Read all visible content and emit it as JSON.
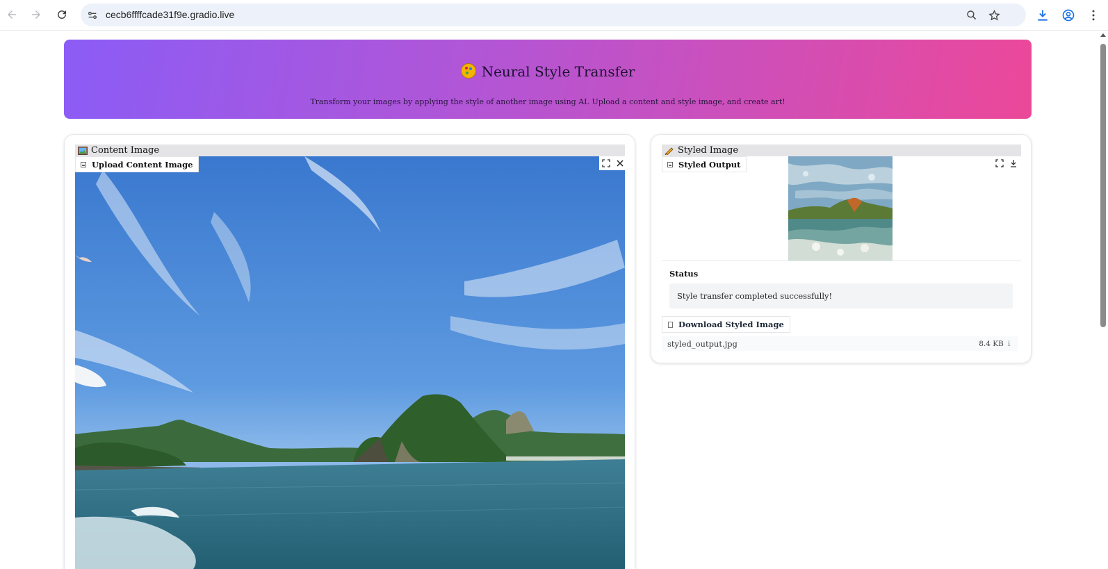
{
  "browser": {
    "url": "cecb6ffffcade31f9e.gradio.live",
    "icons": [
      "back-icon",
      "forward-icon",
      "reload-icon",
      "site-info-icon",
      "zoom-icon",
      "bookmark-star-icon",
      "download-icon",
      "profile-icon",
      "menu-icon"
    ]
  },
  "header": {
    "title": "Neural Style Transfer",
    "subtitle": "Transform your images by applying the style of another image using AI. Upload a content and style image, and create art!"
  },
  "content_panel": {
    "section_label": "Content Image",
    "upload_tag": "Upload Content Image"
  },
  "styled_panel": {
    "section_label": "Styled Image",
    "output_tag": "Styled Output",
    "status_label": "Status",
    "status_text": "Style transfer completed successfully!",
    "download_label": "Download Styled Image",
    "file_name": "styled_output.jpg",
    "file_size": "8.4 KB ⇣"
  },
  "colors": {
    "banner_start": "#8b5cf6",
    "banner_end": "#ec4899",
    "accent_blue": "#1a73e8"
  }
}
